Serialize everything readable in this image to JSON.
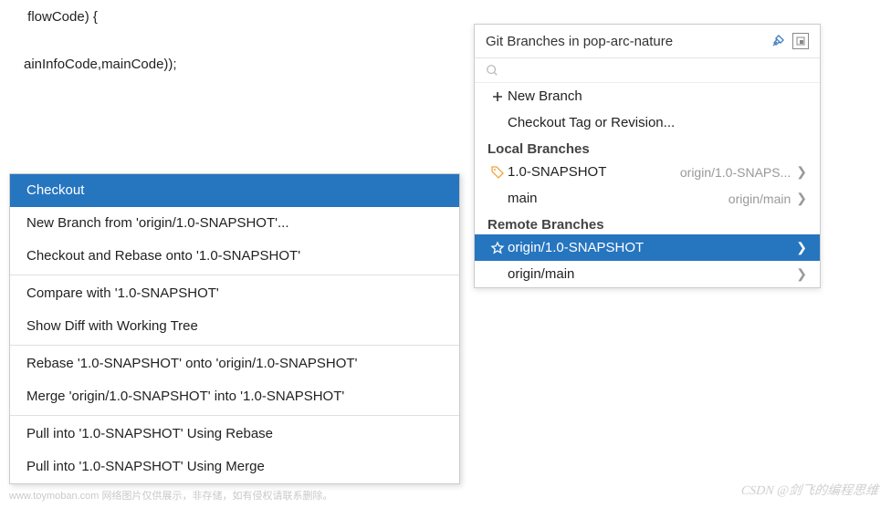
{
  "code": {
    "line1_a": " flowCode) {",
    "line2_a": "ainInfoCode,mainCode));",
    "gutter1": "",
    "gutter2": ""
  },
  "contextMenu": {
    "groups": [
      [
        "Checkout",
        "New Branch from 'origin/1.0-SNAPSHOT'...",
        "Checkout and Rebase onto '1.0-SNAPSHOT'"
      ],
      [
        "Compare with '1.0-SNAPSHOT'",
        "Show Diff with Working Tree"
      ],
      [
        "Rebase '1.0-SNAPSHOT' onto 'origin/1.0-SNAPSHOT'",
        "Merge 'origin/1.0-SNAPSHOT' into '1.0-SNAPSHOT'"
      ],
      [
        "Pull into '1.0-SNAPSHOT' Using Rebase",
        "Pull into '1.0-SNAPSHOT' Using Merge"
      ]
    ],
    "selected": "Checkout"
  },
  "branches": {
    "title": "Git Branches in pop-arc-nature",
    "newBranch": "New Branch",
    "checkoutTag": "Checkout Tag or Revision...",
    "localHeader": "Local Branches",
    "remoteHeader": "Remote Branches",
    "local": [
      {
        "name": "1.0-SNAPSHOT",
        "track": "origin/1.0-SNAPS..."
      },
      {
        "name": "main",
        "track": "origin/main"
      }
    ],
    "remote": [
      {
        "name": "origin/1.0-SNAPSHOT",
        "selected": true,
        "star": true
      },
      {
        "name": "origin/main"
      }
    ]
  },
  "footer": {
    "wm": "www.toymoban.com 网络图片仅供展示，非存储，如有侵权请联系删除。",
    "credit": "CSDN @剑飞的编程思维"
  }
}
